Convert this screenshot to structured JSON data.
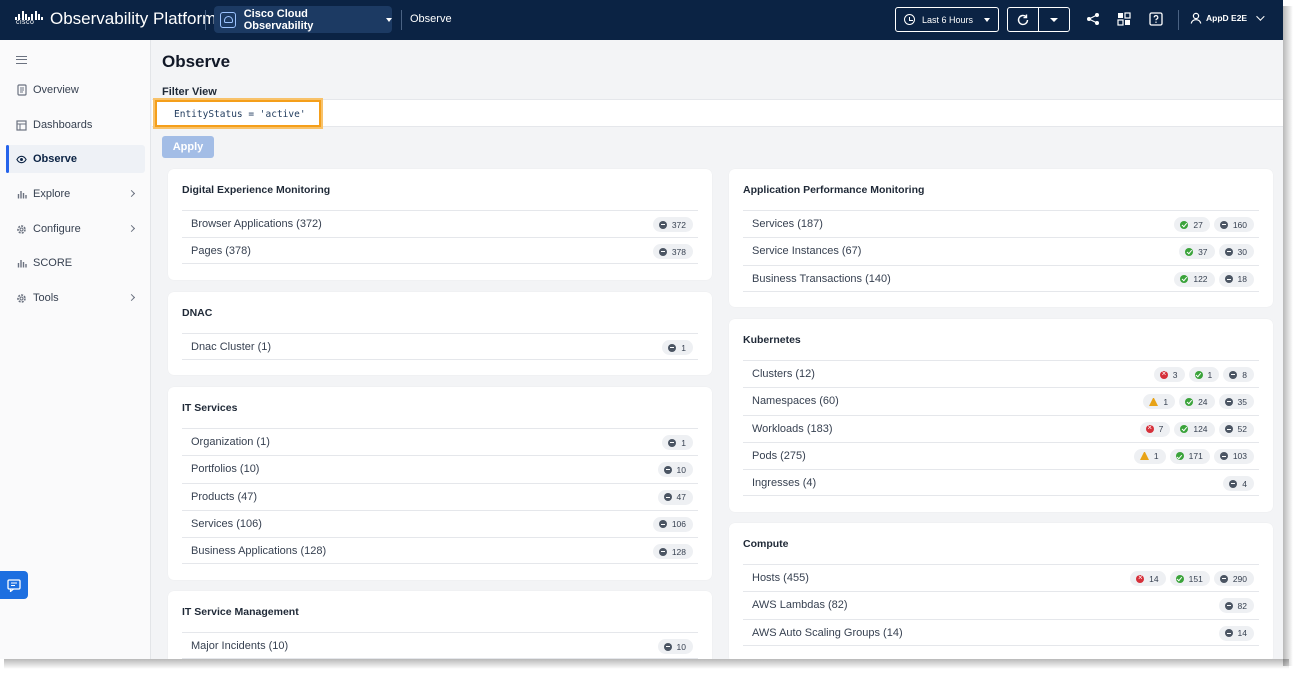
{
  "header": {
    "brand_word": "cisco",
    "platform_title": "Observability Platform",
    "tenant": "Cisco Cloud Observability",
    "breadcrumb": "Observe",
    "time_range": "Last 6 Hours",
    "user": "AppD E2E"
  },
  "sidebar": {
    "items": [
      {
        "label": "Overview",
        "icon": "document-icon"
      },
      {
        "label": "Dashboards",
        "icon": "dashboard-icon"
      },
      {
        "label": "Observe",
        "icon": "eye-icon",
        "active": true
      },
      {
        "label": "Explore",
        "icon": "chart-icon",
        "chevron": true
      },
      {
        "label": "Configure",
        "icon": "gear-icon",
        "chevron": true
      },
      {
        "label": "SCORE",
        "icon": "chart-icon"
      },
      {
        "label": "Tools",
        "icon": "gear-icon",
        "chevron": true
      }
    ]
  },
  "main": {
    "title": "Observe",
    "filter_label": "Filter View",
    "filter_value": "EntityStatus = 'active'",
    "apply_label": "Apply"
  },
  "colors": {
    "accent": "#2563eb",
    "ok": "#3aa33a",
    "critical": "#d6303a",
    "warning": "#e8a317",
    "neutral": "#4b5563"
  },
  "cards": [
    {
      "title": "Digital Experience Monitoring",
      "rows": [
        {
          "label": "Browser Applications (372)",
          "badges": [
            {
              "status": "neutral",
              "count": "372"
            }
          ]
        },
        {
          "label": "Pages (378)",
          "badges": [
            {
              "status": "neutral",
              "count": "378"
            }
          ]
        }
      ]
    },
    {
      "title": "DNAC",
      "rows": [
        {
          "label": "Dnac Cluster (1)",
          "badges": [
            {
              "status": "neutral",
              "count": "1"
            }
          ]
        }
      ]
    },
    {
      "title": "IT Services",
      "rows": [
        {
          "label": "Organization (1)",
          "badges": [
            {
              "status": "neutral",
              "count": "1"
            }
          ]
        },
        {
          "label": "Portfolios (10)",
          "badges": [
            {
              "status": "neutral",
              "count": "10"
            }
          ]
        },
        {
          "label": "Products (47)",
          "badges": [
            {
              "status": "neutral",
              "count": "47"
            }
          ]
        },
        {
          "label": "Services (106)",
          "badges": [
            {
              "status": "neutral",
              "count": "106"
            }
          ]
        },
        {
          "label": "Business Applications (128)",
          "badges": [
            {
              "status": "neutral",
              "count": "128"
            }
          ]
        }
      ]
    },
    {
      "title": "IT Service Management",
      "rows": [
        {
          "label": "Major Incidents (10)",
          "badges": [
            {
              "status": "neutral",
              "count": "10"
            }
          ]
        }
      ]
    },
    {
      "title": "Application Performance Monitoring",
      "rows": [
        {
          "label": "Services (187)",
          "badges": [
            {
              "status": "ok",
              "count": "27"
            },
            {
              "status": "neutral",
              "count": "160"
            }
          ]
        },
        {
          "label": "Service Instances (67)",
          "badges": [
            {
              "status": "ok",
              "count": "37"
            },
            {
              "status": "neutral",
              "count": "30"
            }
          ]
        },
        {
          "label": "Business Transactions (140)",
          "badges": [
            {
              "status": "ok",
              "count": "122"
            },
            {
              "status": "neutral",
              "count": "18"
            }
          ]
        }
      ]
    },
    {
      "title": "Kubernetes",
      "rows": [
        {
          "label": "Clusters (12)",
          "badges": [
            {
              "status": "err",
              "count": "3"
            },
            {
              "status": "ok",
              "count": "1"
            },
            {
              "status": "neutral",
              "count": "8"
            }
          ]
        },
        {
          "label": "Namespaces (60)",
          "badges": [
            {
              "status": "warn",
              "count": "1"
            },
            {
              "status": "ok",
              "count": "24"
            },
            {
              "status": "neutral",
              "count": "35"
            }
          ]
        },
        {
          "label": "Workloads (183)",
          "badges": [
            {
              "status": "err",
              "count": "7"
            },
            {
              "status": "ok",
              "count": "124"
            },
            {
              "status": "neutral",
              "count": "52"
            }
          ]
        },
        {
          "label": "Pods (275)",
          "badges": [
            {
              "status": "warn",
              "count": "1"
            },
            {
              "status": "ok",
              "count": "171"
            },
            {
              "status": "neutral",
              "count": "103"
            }
          ]
        },
        {
          "label": "Ingresses (4)",
          "badges": [
            {
              "status": "neutral",
              "count": "4"
            }
          ]
        }
      ]
    },
    {
      "title": "Compute",
      "rows": [
        {
          "label": "Hosts (455)",
          "badges": [
            {
              "status": "err",
              "count": "14"
            },
            {
              "status": "ok",
              "count": "151"
            },
            {
              "status": "neutral",
              "count": "290"
            }
          ]
        },
        {
          "label": "AWS Lambdas (82)",
          "badges": [
            {
              "status": "neutral",
              "count": "82"
            }
          ]
        },
        {
          "label": "AWS Auto Scaling Groups (14)",
          "badges": [
            {
              "status": "neutral",
              "count": "14"
            }
          ]
        }
      ]
    }
  ]
}
